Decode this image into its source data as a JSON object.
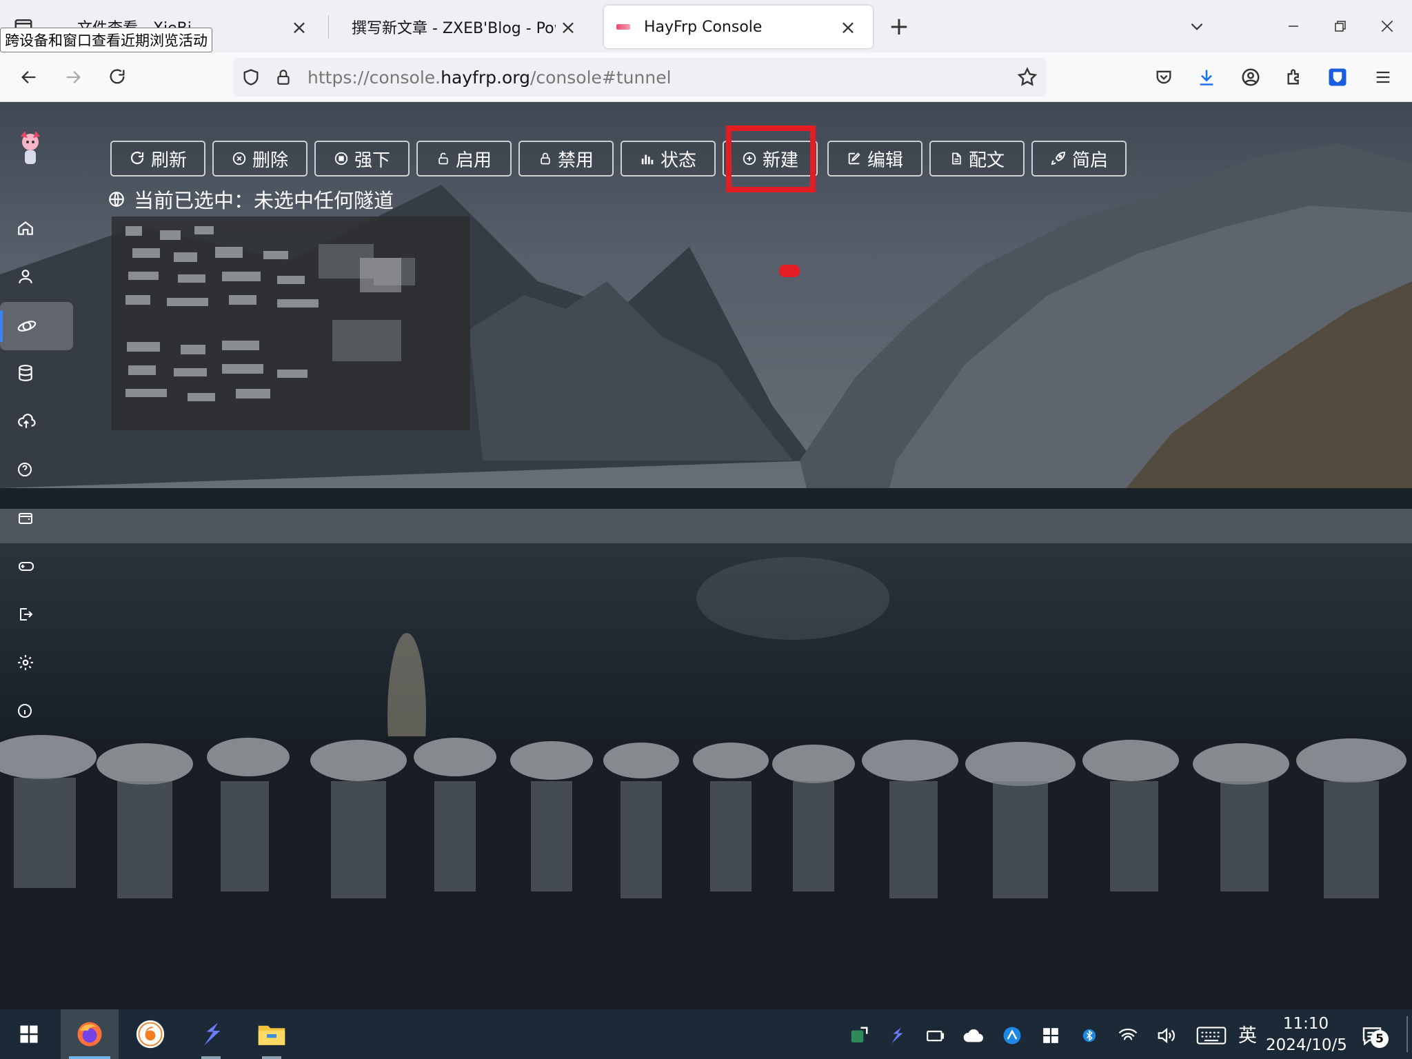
{
  "browser": {
    "tooltip": "跨设备和窗口查看近期浏览活动",
    "tabs": [
      {
        "title": "文件查看 - XieBi",
        "active": false
      },
      {
        "title": "撰写新文章 - ZXEB'Blog - Powered",
        "active": false
      },
      {
        "title": "HayFrp Console",
        "active": true
      }
    ],
    "close_glyph": "×",
    "new_tab_glyph": "+",
    "url": {
      "prefix": "https://console.",
      "domain": "hayfrp.org",
      "path": "/console#tunnel"
    }
  },
  "page": {
    "toolbar": [
      {
        "label": "刷新",
        "icon": "refresh-icon"
      },
      {
        "label": "删除",
        "icon": "x-circle-icon"
      },
      {
        "label": "强下",
        "icon": "stop-circle-icon"
      },
      {
        "label": "启用",
        "icon": "unlock-icon"
      },
      {
        "label": "禁用",
        "icon": "lock-icon"
      },
      {
        "label": "状态",
        "icon": "bar-chart-icon"
      },
      {
        "label": "新建",
        "icon": "plus-circle-icon",
        "highlighted": true
      },
      {
        "label": "编辑",
        "icon": "edit-icon"
      },
      {
        "label": "配文",
        "icon": "file-icon"
      },
      {
        "label": "简启",
        "icon": "rocket-icon"
      }
    ],
    "status_line": "当前已选中：未选中任何隧道",
    "sidebar": [
      "avatar",
      "home-icon",
      "user-icon",
      "tunnel-icon",
      "database-icon",
      "cloud-upload-icon",
      "help-icon",
      "wallet-icon",
      "gamepad-icon",
      "logout-icon",
      "settings-icon",
      "info-icon"
    ],
    "sidebar_active": "tunnel-icon",
    "highlight_color": "#e41c24"
  },
  "taskbar": {
    "ime": "英",
    "time": "11:10",
    "date": "2024/10/5",
    "notifications": "5"
  }
}
